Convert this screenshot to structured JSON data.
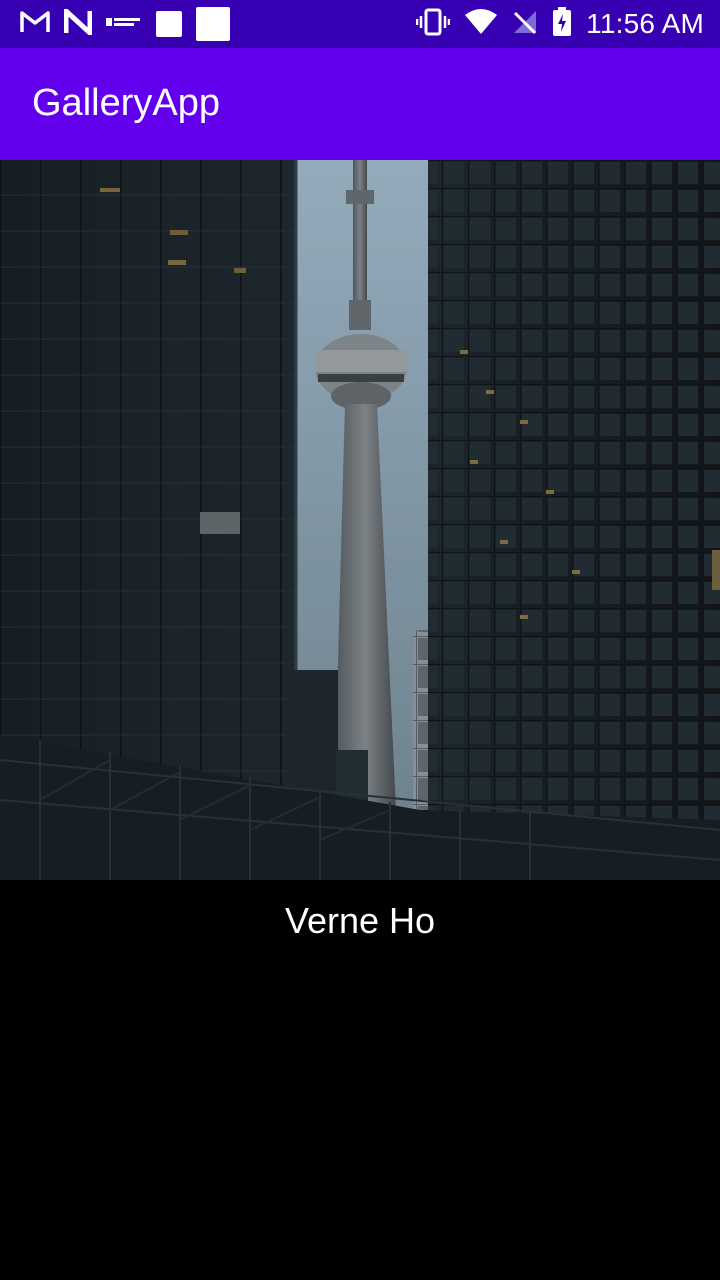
{
  "status_bar": {
    "time": "11:56 AM",
    "left_icons": [
      "gmail-icon",
      "n-logo-icon",
      "notification-text-icon",
      "placeholder-square-icon",
      "placeholder-square-icon"
    ],
    "right_icons": [
      "vibrate-icon",
      "wifi-icon",
      "no-signal-icon",
      "battery-charging-icon"
    ]
  },
  "app_bar": {
    "title": "GalleryApp"
  },
  "photo": {
    "subject": "city-tower-between-skyscrapers"
  },
  "author": {
    "name": "Verne Ho"
  },
  "colors": {
    "status_bar": "#3700b3",
    "app_bar": "#6200ee",
    "background": "#000000",
    "text": "#ffffff"
  }
}
